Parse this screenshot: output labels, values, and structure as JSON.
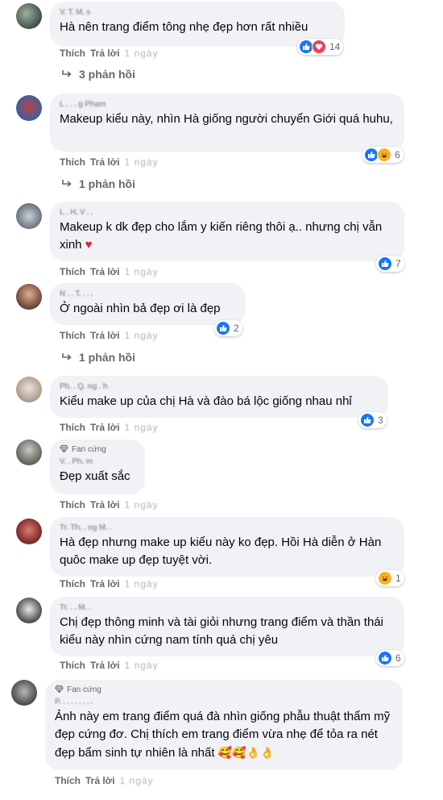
{
  "labels": {
    "like": "Thích",
    "reply": "Trả lời",
    "fan_badge": "Fan cứng"
  },
  "comments": [
    {
      "author": "V. T. M. s",
      "text": "Hà nên trang điểm tông nhẹ đẹp hơn rất nhiều",
      "time": "1 ngày",
      "reaction_count": "14",
      "replies": "3 phản hồi"
    },
    {
      "author": "L . . . g Phạm",
      "text": "Makeup kiểu này, nhìn Hà giống người chuyển Giới quá huhu,",
      "time": "1 ngày",
      "reaction_count": "6",
      "replies": "1 phản hồi"
    },
    {
      "author": "L . H. V . .",
      "text": "Makeup k dk đẹp cho lắm y kiến riêng thôi ạ.. nhưng chị vẫn xinh",
      "emoji": "♥",
      "time": "1 ngày",
      "reaction_count": "7"
    },
    {
      "author": "N . . T. . . .",
      "text": "Ở ngoài nhìn bả đẹp ơi là đẹp",
      "time": "1 ngày",
      "reaction_count": "2",
      "replies": "1 phản hồi"
    },
    {
      "author": "Ph. . Q. ng . h",
      "text": "Kiểu make up của chị Hà và đào bá lộc giống nhau nhỉ",
      "time": "1 ngày",
      "reaction_count": "3"
    },
    {
      "author": "V. . Ph. m",
      "text": "Đẹp xuất sắc",
      "time": "1 ngày"
    },
    {
      "author": "Tr. Th. . ng M. .",
      "text": "Hà đẹp nhưng make up kiểu này ko đẹp. Hồi Hà diễn ở Hàn quôc make up đẹp tuyệt vời.",
      "time": "1 ngày",
      "reaction_count": "1"
    },
    {
      "author": "Tr. . . M. .",
      "text": "Chị đẹp thông minh và tài giỏi nhưng trang điểm và thần thái kiểu này nhìn cứng nam tính quá chị yêu",
      "time": "1 ngày",
      "reaction_count": "6"
    },
    {
      "author": "P. . . . . . . . .",
      "text": "Ảnh này em trang điểm quá đà nhìn giống phẫu thuật thẩm mỹ đẹp cứng đơ. Chị thích em trang điểm vừa nhẹ để tỏa ra nét đẹp bẩm sinh tự nhiên là nhất",
      "emoji": "🥰🥰👌👌",
      "time": "1 ngày"
    }
  ]
}
